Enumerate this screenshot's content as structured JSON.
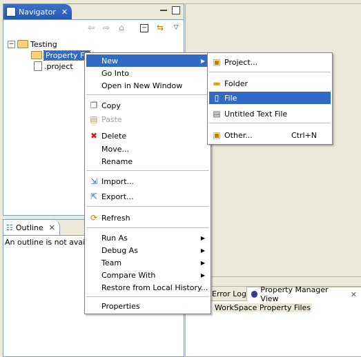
{
  "navigator": {
    "title": "Navigator",
    "close": "✕",
    "tree": [
      {
        "label": "Testing",
        "expander": "−"
      },
      {
        "label": "Property Fil",
        "selected": true
      },
      {
        "label": ".project"
      }
    ]
  },
  "outline": {
    "title": "Outline",
    "close": "✕",
    "message": "An outline is not availab"
  },
  "bottom_right": {
    "tabs": [
      {
        "label": "Error Log"
      },
      {
        "label": "Property Manager View",
        "close": "✕"
      }
    ],
    "tree_item": "WorkSpace Property Files"
  },
  "context_menu": {
    "items": [
      {
        "label": "New",
        "submenu": true,
        "highlighted": true
      },
      {
        "label": "Go Into"
      },
      {
        "label": "Open in New Window"
      },
      {
        "label": "Copy",
        "icon": "copy-icon"
      },
      {
        "label": "Paste",
        "icon": "paste-icon",
        "disabled": true
      },
      {
        "label": "Delete",
        "icon": "delete-icon"
      },
      {
        "label": "Move..."
      },
      {
        "label": "Rename"
      },
      {
        "label": "Import...",
        "icon": "import-icon"
      },
      {
        "label": "Export...",
        "icon": "export-icon"
      },
      {
        "label": "Refresh",
        "icon": "refresh-icon"
      },
      {
        "label": "Run As",
        "submenu": true
      },
      {
        "label": "Debug As",
        "submenu": true
      },
      {
        "label": "Team",
        "submenu": true
      },
      {
        "label": "Compare With",
        "submenu": true
      },
      {
        "label": "Restore from Local History..."
      },
      {
        "label": "Properties"
      }
    ]
  },
  "new_submenu": {
    "items": [
      {
        "label": "Project...",
        "icon": "new-project-icon"
      },
      {
        "label": "Folder",
        "icon": "folder-icon"
      },
      {
        "label": "File",
        "icon": "new-file-icon",
        "highlighted": true
      },
      {
        "label": "Untitled Text File",
        "icon": "text-file-icon"
      },
      {
        "label": "Other...",
        "icon": "wizard-icon",
        "accelerator": "Ctrl+N"
      }
    ]
  },
  "colors": {
    "highlight": "#316ac5",
    "active_tab": "#2459b6",
    "background": "#ece9d8"
  }
}
